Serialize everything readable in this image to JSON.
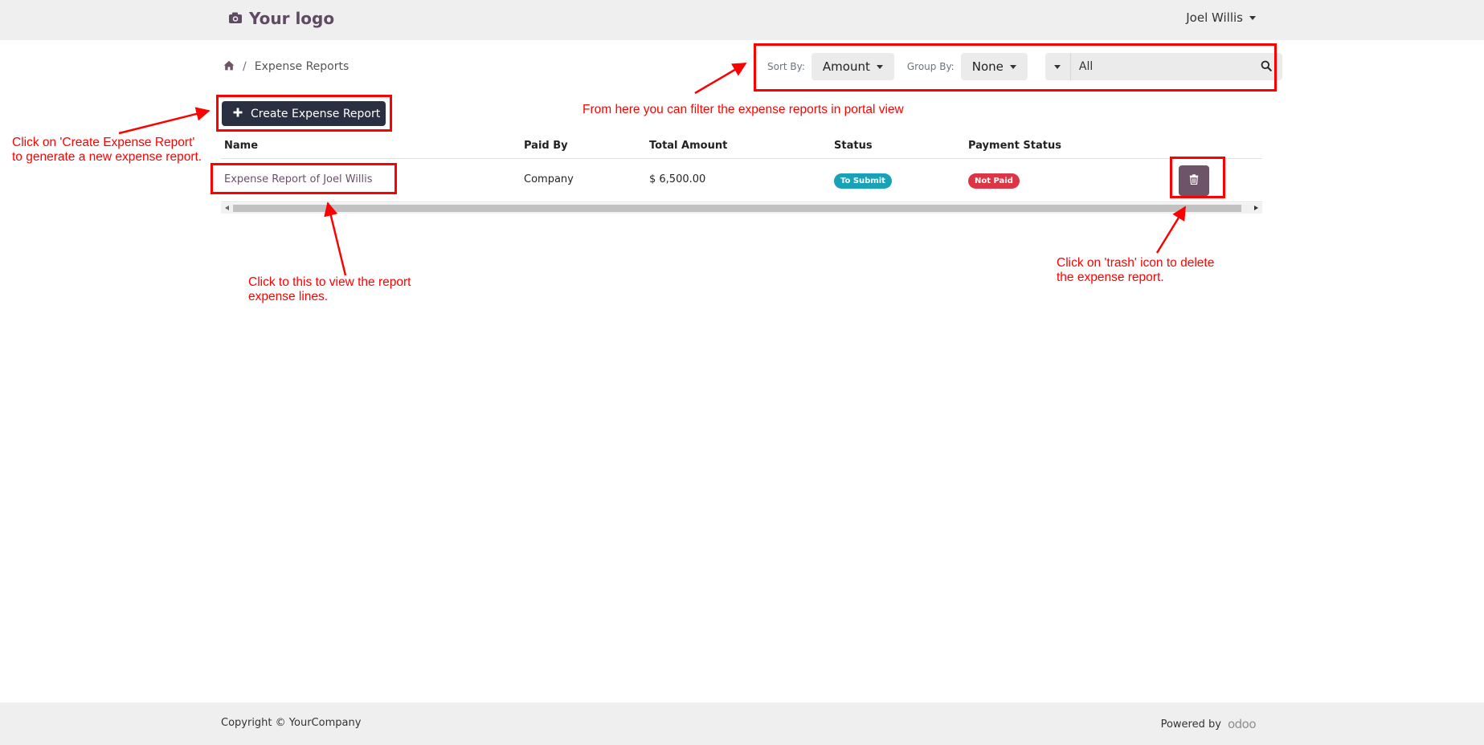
{
  "header": {
    "logo_text": "Your logo",
    "user_name": "Joel Willis"
  },
  "breadcrumb": {
    "current": "Expense Reports"
  },
  "filters": {
    "sort_label": "Sort By:",
    "sort_value": "Amount",
    "group_label": "Group By:",
    "group_value": "None",
    "search_value": "All"
  },
  "actions": {
    "create_label": "Create Expense Report"
  },
  "table": {
    "columns": [
      "Name",
      "Paid By",
      "Total Amount",
      "Status",
      "Payment Status"
    ],
    "rows": [
      {
        "name": "Expense Report of Joel Willis",
        "paid_by": "Company",
        "total": "$ 6,500.00",
        "status": "To Submit",
        "payment_status": "Not Paid"
      }
    ]
  },
  "footer": {
    "copyright": "Copyright © YourCompany",
    "powered_by": "Powered by",
    "brand": "odoo"
  },
  "annotations": {
    "create_line1": "Click on 'Create Expense Report'",
    "create_line2": "to generate a new expense report.",
    "filter_note": "From here you can filter the expense reports in portal view",
    "view_line1": "Click to this to view the report",
    "view_line2": "expense lines.",
    "trash_line1": "Click on 'trash' icon to delete",
    "trash_line2": "the expense report."
  },
  "colors": {
    "primary": "#6d5468",
    "link": "#6a4f6d",
    "dark_button": "#2b2f42",
    "badge_info": "#17a2b8",
    "badge_danger": "#dc3545",
    "annotation": "#ff0000"
  }
}
